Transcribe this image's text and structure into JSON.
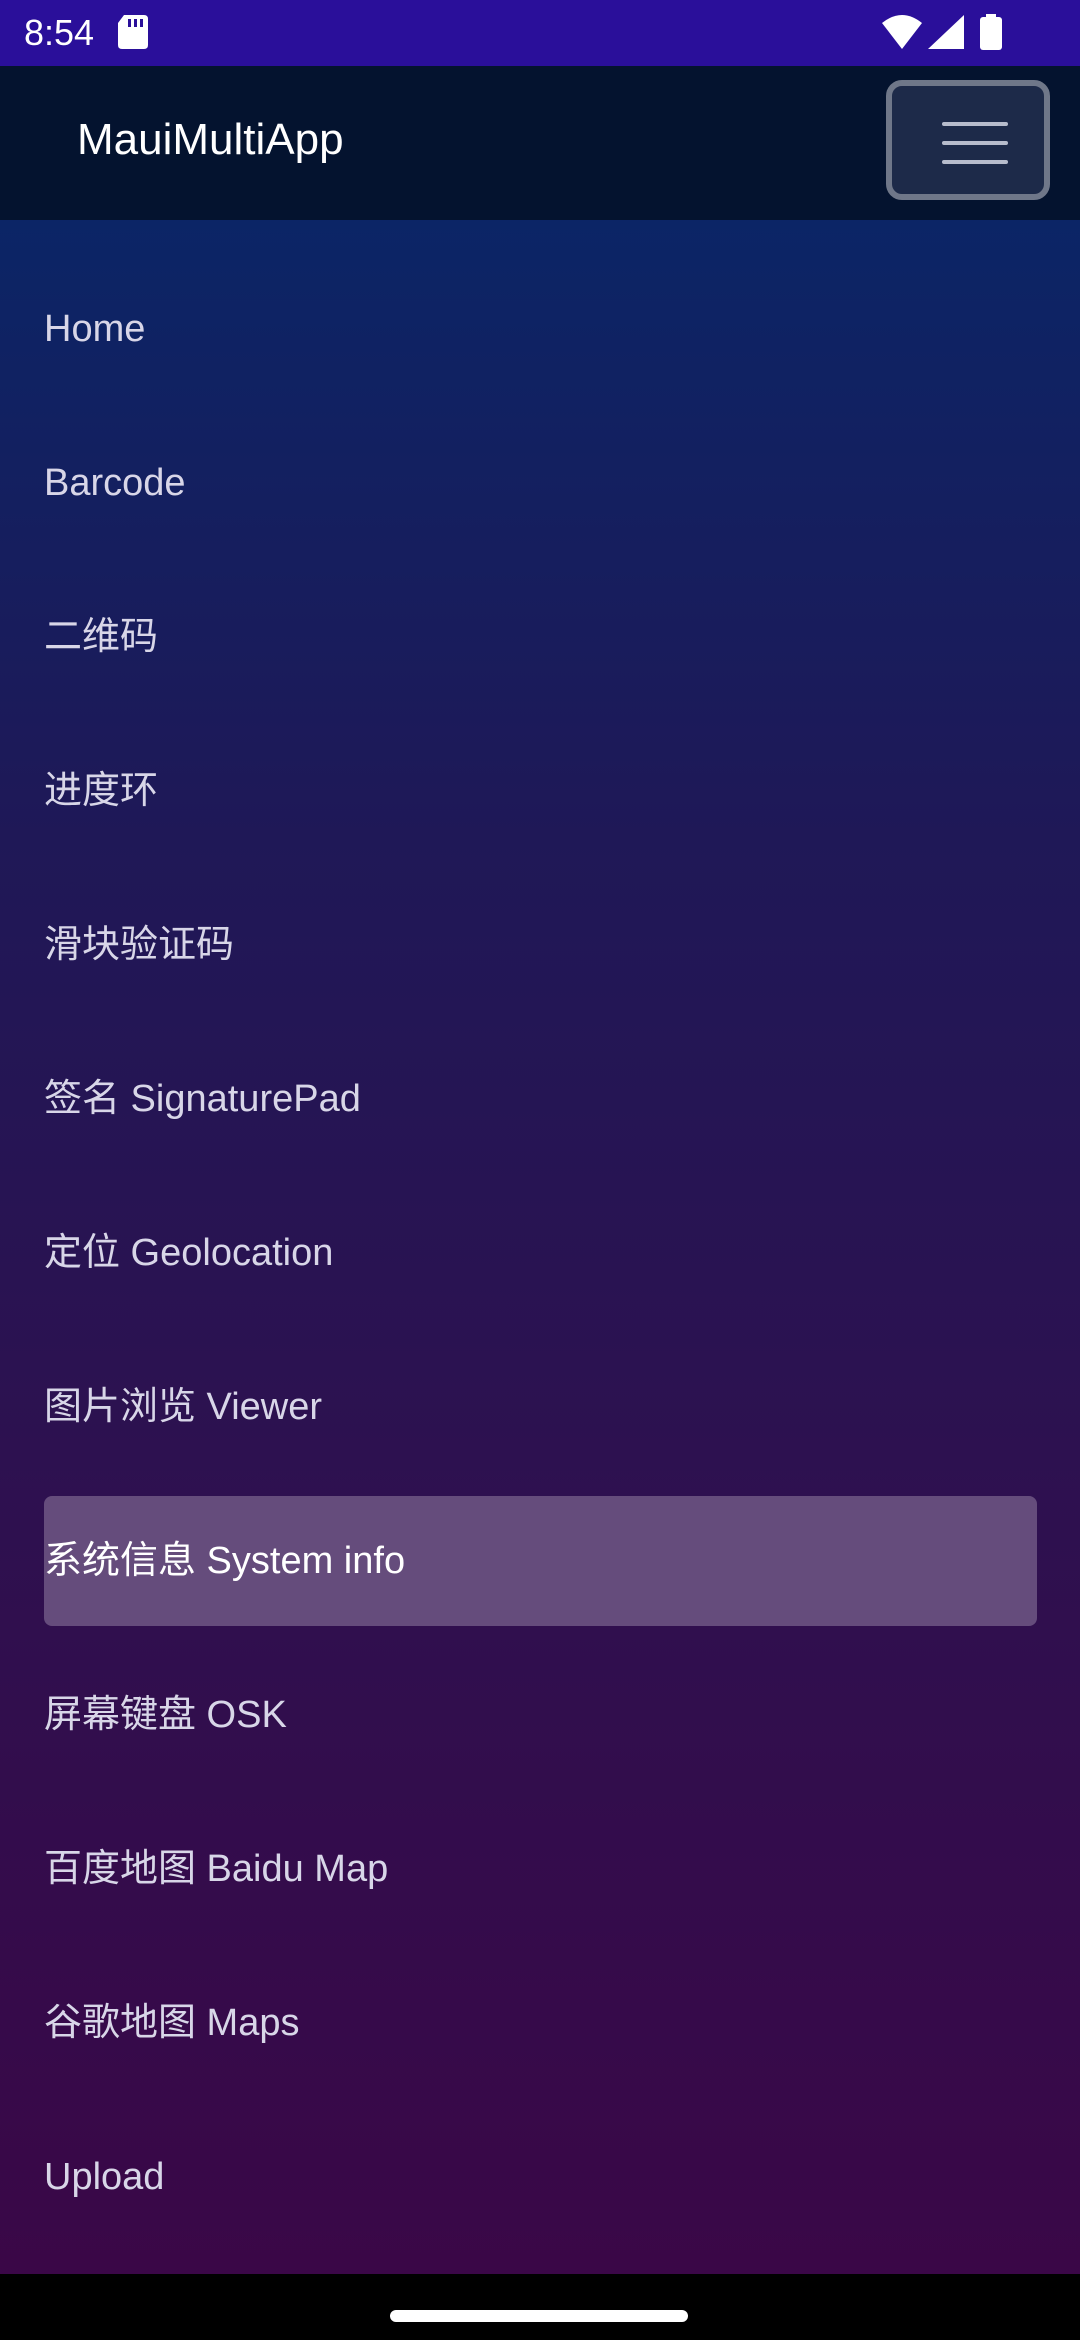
{
  "status_bar": {
    "time": "8:54",
    "icons": [
      "sd-card-icon",
      "wifi-icon",
      "signal-icon",
      "battery-icon"
    ]
  },
  "app_bar": {
    "title": "MauiMultiApp",
    "menu_button_icon": "hamburger-menu-icon"
  },
  "nav": {
    "active_index": 8,
    "items": [
      {
        "label": "Home"
      },
      {
        "label": "Barcode"
      },
      {
        "label": "二维码"
      },
      {
        "label": "进度环"
      },
      {
        "label": "滑块验证码"
      },
      {
        "label": "签名 SignaturePad"
      },
      {
        "label": "定位 Geolocation"
      },
      {
        "label": "图片浏览 Viewer"
      },
      {
        "label": "系统信息 System info"
      },
      {
        "label": "屏幕键盘 OSK"
      },
      {
        "label": "百度地图 Baidu Map"
      },
      {
        "label": "谷歌地图 Maps"
      },
      {
        "label": "Upload"
      }
    ]
  },
  "colors": {
    "status_bar_bg": "#2a0f9a",
    "app_bar_bg": "#04132f",
    "nav_gradient_top": "#0b2566",
    "nav_gradient_bottom": "#3a0747",
    "active_item_bg": "#654c7c"
  }
}
